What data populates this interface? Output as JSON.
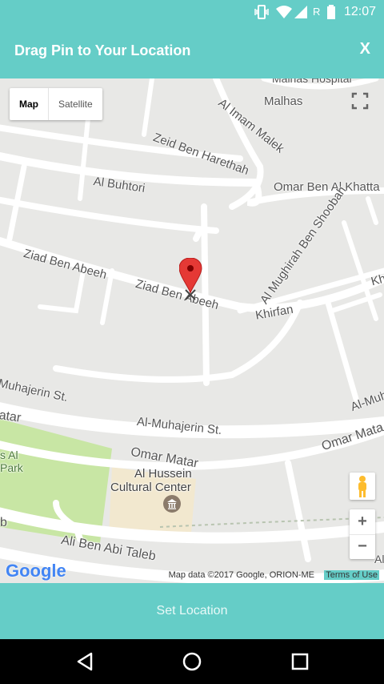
{
  "status_bar": {
    "time": "12:07",
    "carrier_indicator": "R",
    "icons": [
      "vibrate-icon",
      "wifi-icon",
      "signal-icon",
      "battery-icon"
    ]
  },
  "header": {
    "title": "Drag Pin to Your Location",
    "close_label": "X"
  },
  "map": {
    "type_control": {
      "map_label": "Map",
      "satellite_label": "Satellite",
      "selected": "Map"
    },
    "street_labels": [
      "Malhas Hospital",
      "Malhas",
      "Al Imam Malek",
      "Zeid Ben Harethah",
      "Omar Ben Al Khatta",
      "Al Buhtori",
      "Al Mughirah Ben Shoobah",
      "Ziad Ben Abeeh",
      "Ziad Ben Abeeh",
      "Khirfan",
      "Kh",
      "Muhajerin St.",
      "Al-Muhajerin St.",
      "Al-Muh",
      "Omar Matar",
      "Omar Mata",
      "atar",
      "s Al",
      "Park",
      "Ali Ben Abi Taleb",
      "b",
      "Al"
    ],
    "poi": {
      "name_line1": "Al Hussein",
      "name_line2": "Cultural Center"
    },
    "logo": "Google",
    "attribution": "Map data ©2017 Google, ORION-ME",
    "terms_label": "Terms of Use",
    "colors": {
      "road": "#ffffff",
      "land": "#e8e8e6",
      "park": "#c8e6a4",
      "poi_area": "#f2e8cf",
      "pin": "#e53935"
    }
  },
  "action_button": {
    "label": "Set Location"
  },
  "nav_bar": {
    "back": "back-icon",
    "home": "home-icon",
    "recents": "recents-icon"
  },
  "theme": {
    "accent": "#65cdc7"
  }
}
